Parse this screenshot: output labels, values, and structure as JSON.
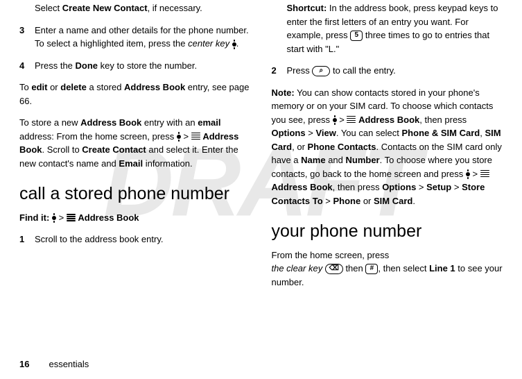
{
  "watermark": "DRAFT",
  "left": {
    "line1a": "Select ",
    "line1b": "Create New Contact",
    "line1c": ", if necessary.",
    "step3num": "3",
    "step3a": "Enter a name and other details for the phone number. To select a highlighted item, press the ",
    "step3b": "center key",
    "step3c": ".",
    "step4num": "4",
    "step4a": "Press the ",
    "step4b": "Done",
    "step4c": " key to store the number.",
    "p1a": "To ",
    "p1b": "edit",
    "p1c": " or ",
    "p1d": "delete",
    "p1e": " a stored ",
    "p1f": "Address Book",
    "p1g": " entry, see page 66.",
    "p2a": "To store a new ",
    "p2b": "Address Book",
    "p2c": " entry with an ",
    "p2d": "email",
    "p2e": " address: From the home screen, press ",
    "p2f": " > ",
    "p2g": "Address Book",
    "p2h": ". Scroll to ",
    "p2i": "Create Contact",
    "p2j": " and select it. Enter the new contact's name and ",
    "p2k": "Email",
    "p2l": " information.",
    "h2": "call a stored phone number",
    "findit_label": "Find it:",
    "findit_sep": " > ",
    "findit_dest": "Address Book",
    "s1num": "1",
    "s1": "Scroll to the address book entry."
  },
  "right": {
    "sc_label": "Shortcut:",
    "sc_a": " In the address book, press keypad keys to enter the first letters of an entry you want. For example, press ",
    "sc_key": "5",
    "sc_b": " three times to go to entries that start with \"L.\"",
    "s2num": "2",
    "s2a": "Press ",
    "s2b": " to call the entry.",
    "note_label": "Note:",
    "note_a": " You can show contacts stored in your phone's memory or on your SIM card. To choose which contacts you see, press ",
    "note_sep": " > ",
    "note_b": "Address Book",
    "note_c": ", then press ",
    "note_d": "Options",
    "note_e": "View",
    "note_f": ". You can select ",
    "note_g": "Phone & SIM Card",
    "note_h": ", ",
    "note_i": "SIM Card",
    "note_j": ", or ",
    "note_k": "Phone Contacts",
    "note_l": ". Contacts on the SIM card only have a ",
    "note_m": "Name",
    "note_n": " and ",
    "note_o": "Number",
    "note_p": ". To choose where you store contacts, go back to the home screen and press ",
    "note_q": "Address Book",
    "note_r": ", then press ",
    "note_s": "Options",
    "note_t": "Setup",
    "note_u": "Store Contacts To",
    "note_v": "Phone",
    "note_w": " or ",
    "note_x": "SIM Card",
    "note_y": ".",
    "h2": "your phone number",
    "yp_a": "From the home screen, press ",
    "yp_b": "the clear key",
    "yp_c": " then ",
    "yp_key2": "#",
    "yp_d": ", then select ",
    "yp_e": "Line 1",
    "yp_f": " to see your number."
  },
  "footer": {
    "page": "16",
    "section": "essentials"
  }
}
